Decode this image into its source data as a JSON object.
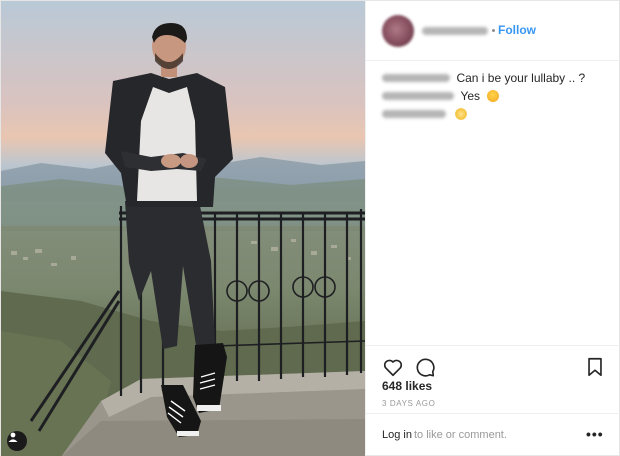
{
  "header": {
    "follow_label": "Follow"
  },
  "comments": [
    {
      "text": "Can i be your lullaby .. ?"
    },
    {
      "text": "Yes"
    },
    {
      "text": ""
    }
  ],
  "actions": {
    "icons": [
      "heart-icon",
      "comment-icon",
      "bookmark-icon"
    ]
  },
  "likes": "648 likes",
  "timestamp": "3 DAYS AGO",
  "footer": {
    "login_label": "Log in",
    "login_suffix": "to like or comment.",
    "more_label": "•••"
  },
  "colors": {
    "link": "#3897f0",
    "text": "#262626",
    "muted": "#999999",
    "border": "#efefef"
  }
}
